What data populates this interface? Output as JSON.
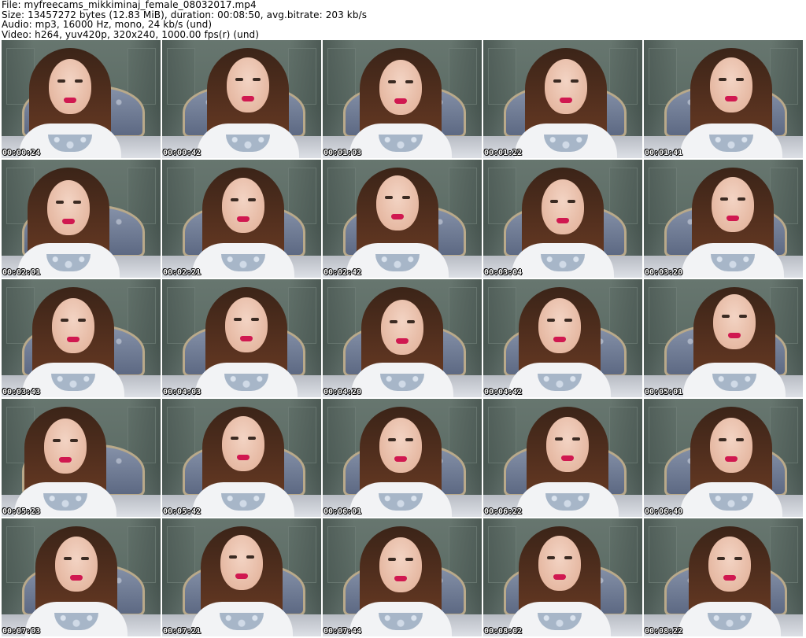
{
  "header": {
    "file_line": "File: myfreecams_mikkiminaj_female_08032017.mp4",
    "size_line": "Size: 13457272 bytes (12.83 MiB), duration: 00:08:50, avg.bitrate: 203 kb/s",
    "audio_line": "Audio: mp3, 16000 Hz, mono, 24 kb/s (und)",
    "video_line": "Video: h264, yuv420p, 320x240, 1000.00 fps(r) (und)"
  },
  "thumbnails": [
    {
      "timestamp": "00:00:24"
    },
    {
      "timestamp": "00:00:42"
    },
    {
      "timestamp": "00:01:03"
    },
    {
      "timestamp": "00:01:22"
    },
    {
      "timestamp": "00:01:41"
    },
    {
      "timestamp": "00:02:01"
    },
    {
      "timestamp": "00:02:21"
    },
    {
      "timestamp": "00:02:42"
    },
    {
      "timestamp": "00:03:04"
    },
    {
      "timestamp": "00:03:20"
    },
    {
      "timestamp": "00:03:43"
    },
    {
      "timestamp": "00:04:03"
    },
    {
      "timestamp": "00:04:20"
    },
    {
      "timestamp": "00:04:42"
    },
    {
      "timestamp": "00:05:01"
    },
    {
      "timestamp": "00:05:23"
    },
    {
      "timestamp": "00:05:42"
    },
    {
      "timestamp": "00:06:01"
    },
    {
      "timestamp": "00:06:22"
    },
    {
      "timestamp": "00:06:40"
    },
    {
      "timestamp": "00:07:03"
    },
    {
      "timestamp": "00:07:21"
    },
    {
      "timestamp": "00:07:44"
    },
    {
      "timestamp": "00:08:02"
    },
    {
      "timestamp": "00:08:22"
    }
  ],
  "colors": {
    "background": "#ffffff",
    "wall": "#5f6e68",
    "timestamp_text": "#ffffff",
    "lips": "#d01850"
  }
}
